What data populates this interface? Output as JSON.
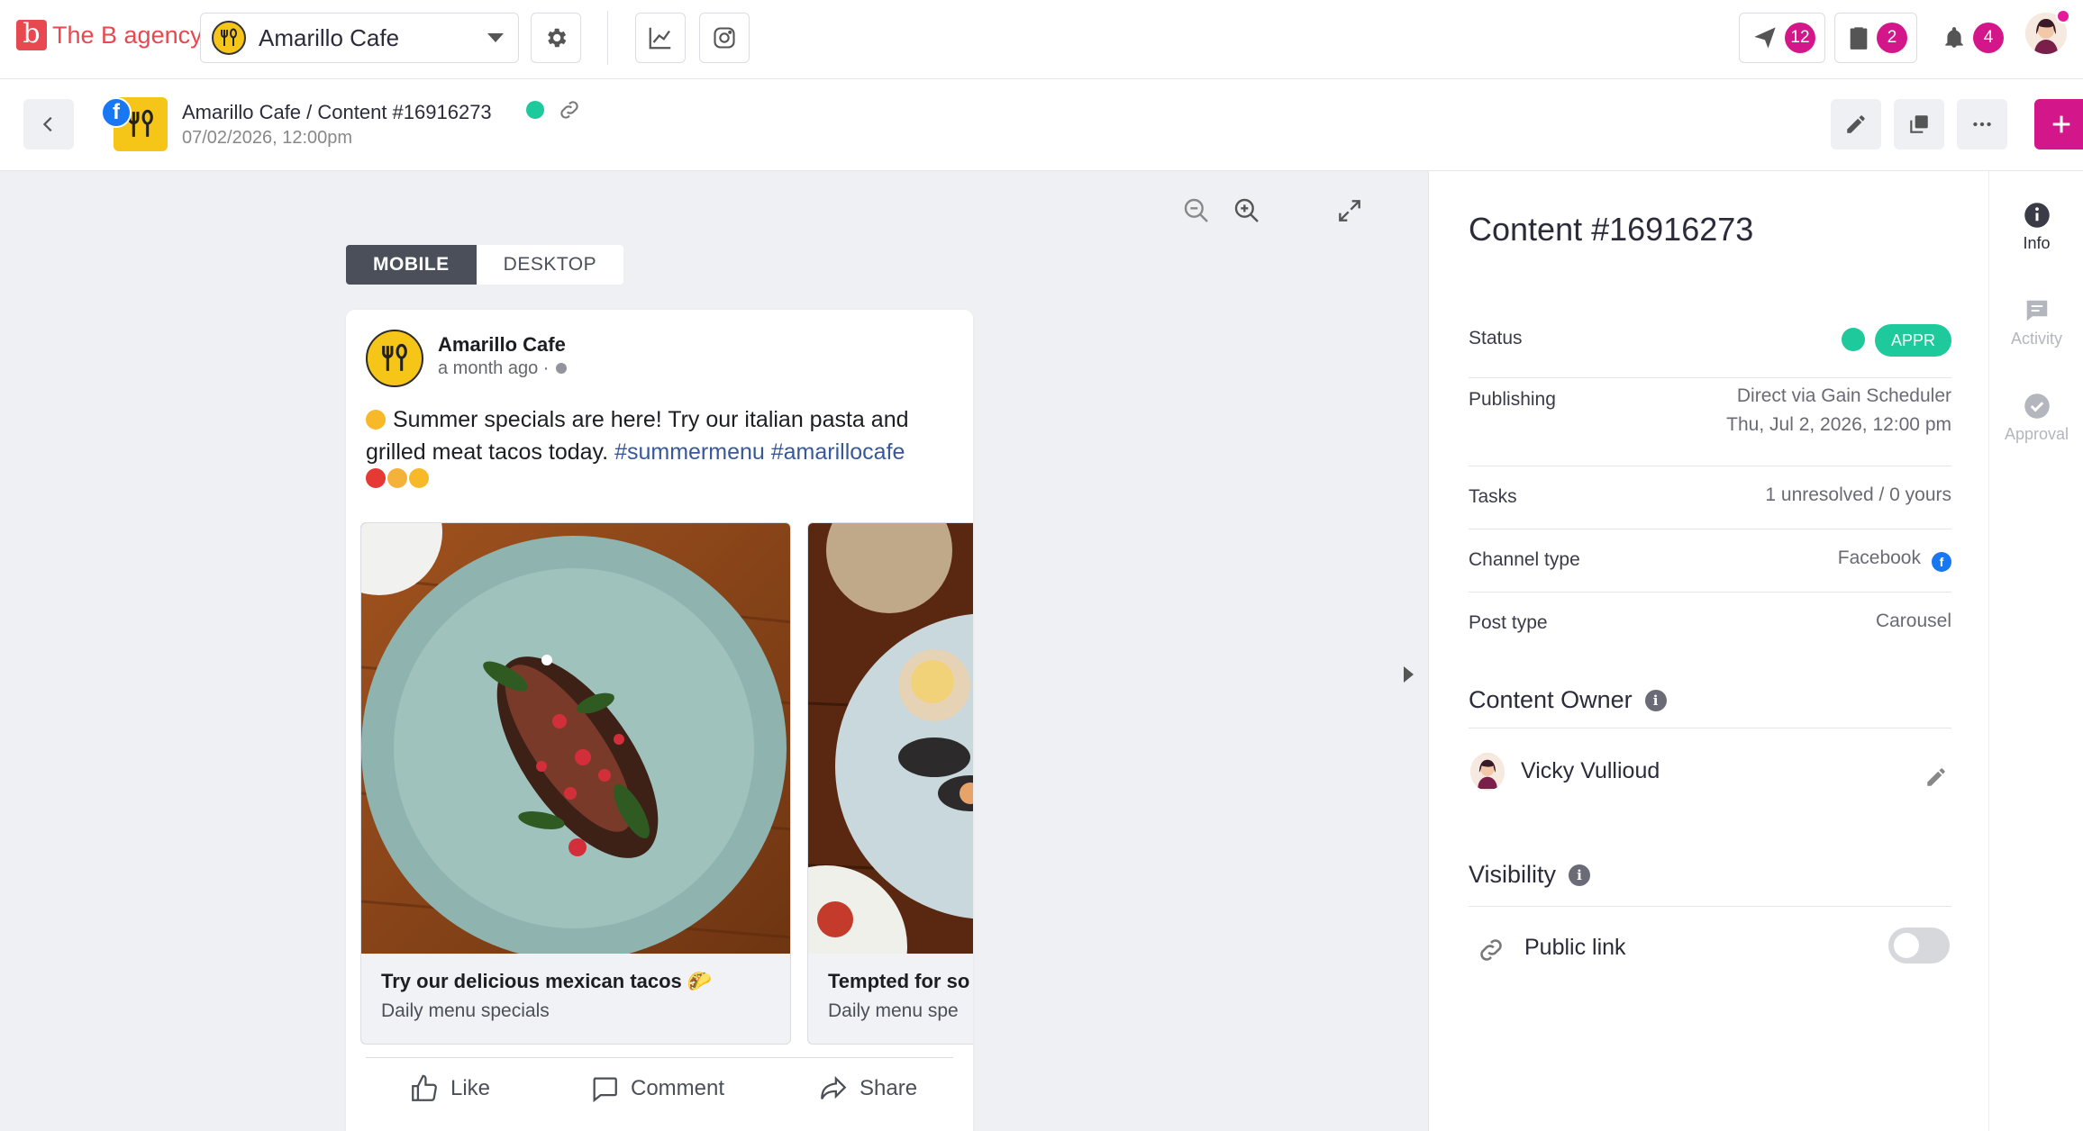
{
  "topbar": {
    "brand_letter": "b",
    "brand_name": "The B agency",
    "account_name": "Amarillo Cafe",
    "counts": {
      "send": "12",
      "tasks": "2",
      "notifications": "4"
    }
  },
  "subbar": {
    "breadcrumb": "Amarillo Cafe / Content #16916273",
    "date": "07/02/2026, 12:00pm"
  },
  "preview": {
    "tabs": {
      "mobile": "MOBILE",
      "desktop": "DESKTOP"
    },
    "post": {
      "page_name": "Amarillo Cafe",
      "time": "a month ago ·",
      "text_before": "Summer specials are here! Try our italian pasta and grilled meat tacos today. ",
      "hashtags": "#summermenu #amarillocafe",
      "slides": [
        {
          "title": "Try our delicious mexican tacos 🌮",
          "subtitle": "Daily menu specials"
        },
        {
          "title": "Tempted for so",
          "subtitle": "Daily menu spe"
        }
      ],
      "actions": {
        "like": "Like",
        "comment": "Comment",
        "share": "Share"
      }
    }
  },
  "panel": {
    "title": "Content #16916273",
    "rows": {
      "status_label": "Status",
      "status_value": "APPR",
      "publishing_label": "Publishing",
      "publishing_line1": "Direct via Gain Scheduler",
      "publishing_line2": "Thu, Jul 2, 2026, 12:00 pm",
      "tasks_label": "Tasks",
      "tasks_value": "1 unresolved / 0 yours",
      "channel_label": "Channel type",
      "channel_value": "Facebook",
      "post_type_label": "Post type",
      "post_type_value": "Carousel"
    },
    "owner_title": "Content Owner",
    "owner_name": "Vicky Vullioud",
    "visibility_title": "Visibility",
    "public_link_label": "Public link",
    "public_link_enabled": false
  },
  "rail": {
    "info": "Info",
    "activity": "Activity",
    "approval": "Approval"
  },
  "colors": {
    "brand": "#e8484f",
    "accent": "#d4168b",
    "approved": "#1ec99b",
    "facebook": "#1877f2"
  }
}
